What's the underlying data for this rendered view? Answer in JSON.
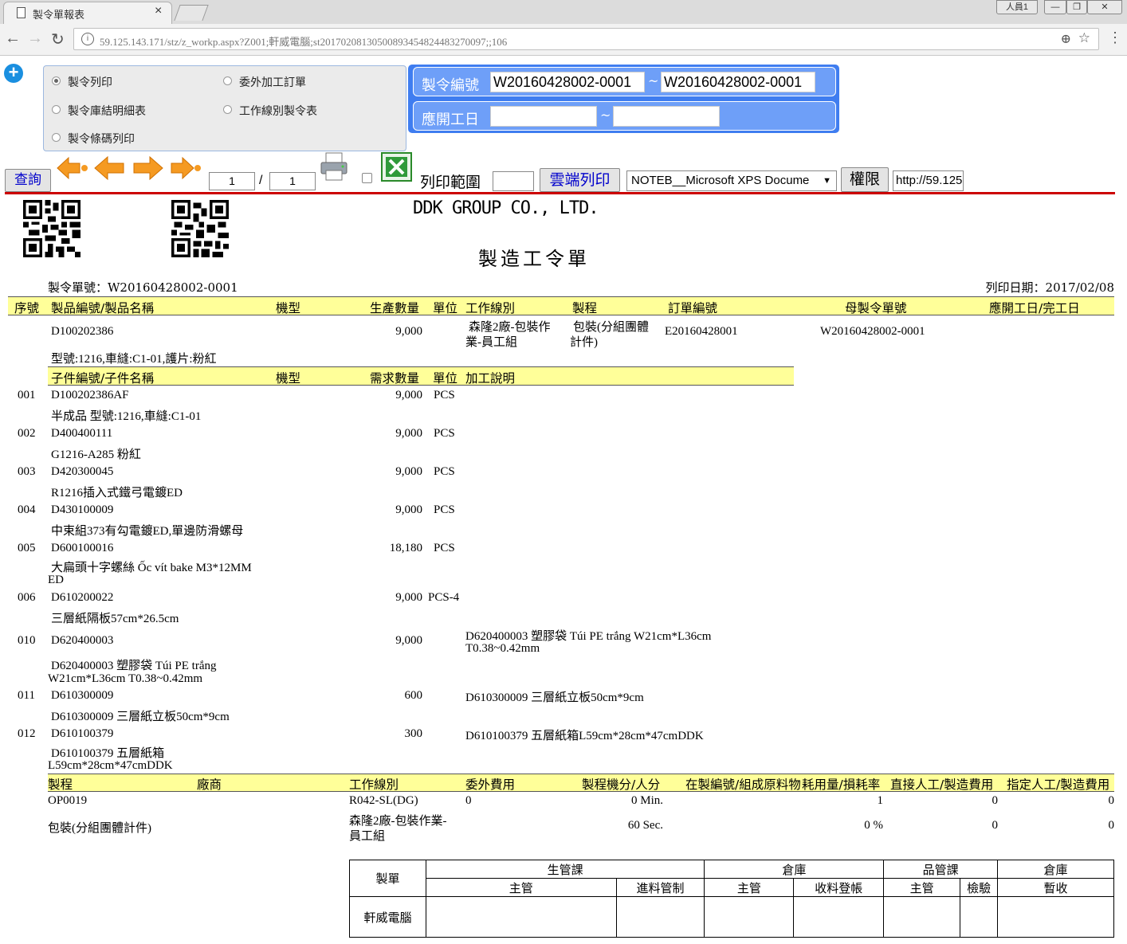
{
  "browser": {
    "tab_title": "製令單報表",
    "tab_close": "×",
    "user_badge": "人員1",
    "url": "59.125.143.171/stz/z_workp.aspx?Z001;軒威電腦;st20170208130500893454824483270097;;106"
  },
  "options": {
    "radios": [
      {
        "label": "製令列印",
        "selected": true
      },
      {
        "label": "委外加工訂單",
        "selected": false
      },
      {
        "label": "製令庫結明細表",
        "selected": false
      },
      {
        "label": "工作線別製令表",
        "selected": false
      },
      {
        "label": "製令條碼列印",
        "selected": false
      }
    ]
  },
  "filters": {
    "order_no_label": "製令編號",
    "order_no_from": "W20160428002-0001",
    "order_no_to": "W20160428002-0001",
    "start_date_label": "應開工日",
    "start_date_from": "",
    "start_date_to": "",
    "range_sep": "~"
  },
  "toolbar": {
    "query": "查詢",
    "page_current": "1",
    "page_sep": "/",
    "page_total": "1",
    "print_range_label": "列印範圍",
    "print_range_value": "",
    "cloud_print": "雲端列印",
    "printer": "NOTEB__Microsoft XPS Docume",
    "permission": "權限",
    "url_field": "http://59.125"
  },
  "report": {
    "company": "DDK GROUP CO., LTD.",
    "title": "製造工令單",
    "order_label": "製令單號：W20160428002-0001",
    "print_date_label": "列印日期：2017/02/08",
    "main_headers": [
      "序號",
      "製品編號/製品名稱",
      "機型",
      "生產數量",
      "單位",
      "工作線別",
      "製程",
      "訂單編號",
      "母製令單號",
      "應開工日/完工日"
    ],
    "product": {
      "code": "D100202386",
      "qty": "9,000",
      "line1": "森隆2廠-包裝作",
      "line2": "業-員工組",
      "process1": "包裝(分組團體",
      "process2": "計件)",
      "order_no": "E20160428001",
      "parent_no": "W20160428002-0001",
      "spec": "型號:1216,車縫:C1-01,護片:粉紅"
    },
    "comp_headers": [
      "子件編號/子件名稱",
      "機型",
      "需求數量",
      "單位",
      "加工說明"
    ],
    "components": [
      {
        "seq": "001",
        "code": "D100202386AF",
        "qty": "9,000",
        "unit": "PCS",
        "note": "",
        "name": "半成品 型號:1216,車縫:C1-01"
      },
      {
        "seq": "002",
        "code": "D400400111",
        "qty": "9,000",
        "unit": "PCS",
        "note": "",
        "name": "G1216-A285 粉紅"
      },
      {
        "seq": "003",
        "code": "D420300045",
        "qty": "9,000",
        "unit": "PCS",
        "note": "",
        "name": "R1216插入式鐵弓電鍍ED"
      },
      {
        "seq": "004",
        "code": "D430100009",
        "qty": "9,000",
        "unit": "PCS",
        "note": "",
        "name": "中束組373有勾電鍍ED,單邊防滑螺母"
      },
      {
        "seq": "005",
        "code": "D600100016",
        "qty": "18,180",
        "unit": "PCS",
        "note": "",
        "name": "大扁頭十字螺絲 Ốc vít bake M3*12MM",
        "name2": "ED"
      },
      {
        "seq": "006",
        "code": "D610200022",
        "qty": "9,000",
        "unit": "PCS-4",
        "note": "",
        "name": "三層紙隔板57cm*26.5cm"
      },
      {
        "seq": "010",
        "code": "D620400003",
        "qty": "9,000",
        "unit": "",
        "note": "D620400003 塑膠袋 Túi PE trắng W21cm*L36cm",
        "note2": "T0.38~0.42mm",
        "name": "D620400003 塑膠袋 Túi PE trắng",
        "name2": "W21cm*L36cm T0.38~0.42mm"
      },
      {
        "seq": "011",
        "code": "D610300009",
        "qty": "600",
        "unit": "",
        "note": "D610300009 三層紙立板50cm*9cm",
        "name": "D610300009 三層紙立板50cm*9cm"
      },
      {
        "seq": "012",
        "code": "D610100379",
        "qty": "300",
        "unit": "",
        "note": "D610100379 五層紙箱L59cm*28cm*47cmDDK",
        "name": "D610100379 五層紙箱",
        "name2": "L59cm*28cm*47cmDDK"
      }
    ],
    "proc_headers": [
      "製程",
      "廠商",
      "工作線別",
      "委外費用",
      "製程機分/人分",
      "在製編號/組成原料物",
      "耗用量/損耗率",
      "直接人工/製造費用",
      "指定人工/製造費用"
    ],
    "process_row": {
      "code": "OP0019",
      "name": "包裝(分組團體計件)",
      "line_code": "R042-SL(DG)",
      "line_name1": "森隆2廠-包裝作業-",
      "line_name2": "員工組",
      "outsource": "0",
      "machine_min": "0 Min.",
      "man_sec": "60 Sec.",
      "usage": "1",
      "loss": "0 %",
      "direct1": "0",
      "direct2": "0",
      "assigned1": "0",
      "assigned2": "0"
    },
    "signoff": {
      "maker": "製單",
      "prod_dept": "生管課",
      "warehouse1": "倉庫",
      "qc_dept": "品管課",
      "warehouse2": "倉庫",
      "supervisor": "主管",
      "material_ctrl": "進料管制",
      "wh_supervisor": "主管",
      "receiving": "收料登帳",
      "qc_supervisor": "主管",
      "inspection": "檢驗",
      "temp_receipt": "暫收",
      "company_name": "軒威電腦"
    }
  }
}
